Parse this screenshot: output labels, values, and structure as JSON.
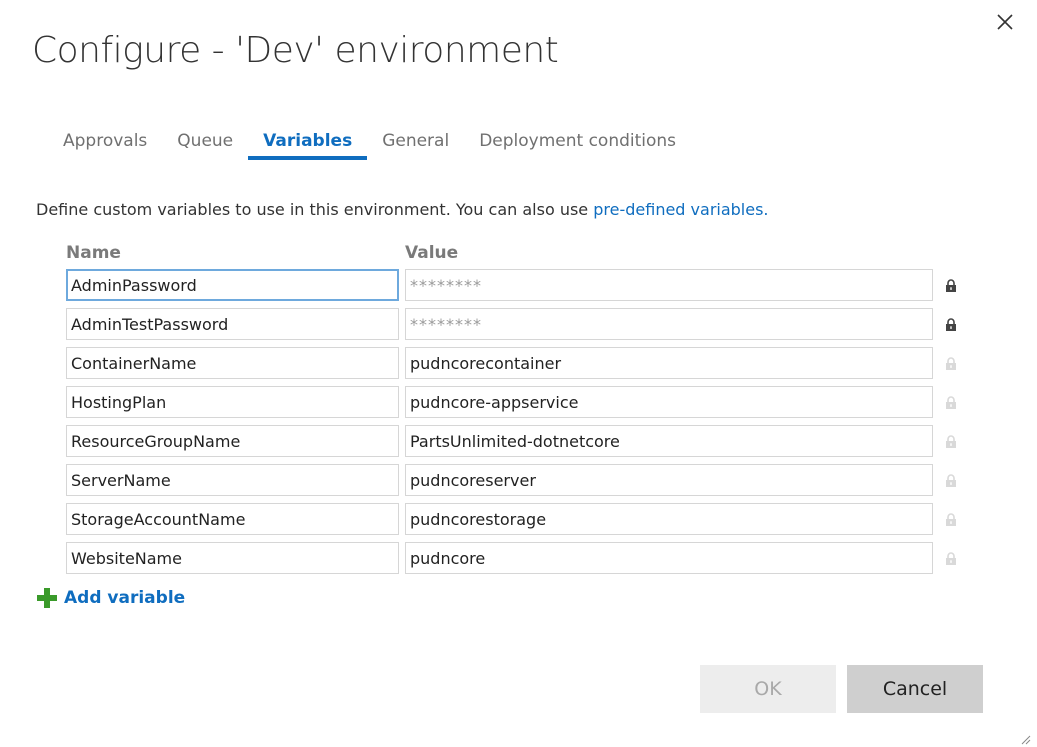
{
  "dialog": {
    "title": "Configure - 'Dev' environment",
    "tabs": [
      {
        "label": "Approvals",
        "active": false
      },
      {
        "label": "Queue",
        "active": false
      },
      {
        "label": "Variables",
        "active": true
      },
      {
        "label": "General",
        "active": false
      },
      {
        "label": "Deployment conditions",
        "active": false
      }
    ],
    "description": "Define custom variables to use in this environment. You can also use",
    "description_link": "pre-defined variables.",
    "columns": {
      "name": "Name",
      "value": "Value"
    },
    "variables": [
      {
        "name": "AdminPassword",
        "value": "********",
        "secret": true
      },
      {
        "name": "AdminTestPassword",
        "value": "********",
        "secret": true
      },
      {
        "name": "ContainerName",
        "value": "pudncorecontainer",
        "secret": false
      },
      {
        "name": "HostingPlan",
        "value": "pudncore-appservice",
        "secret": false
      },
      {
        "name": "ResourceGroupName",
        "value": "PartsUnlimited-dotnetcore",
        "secret": false
      },
      {
        "name": "ServerName",
        "value": "pudncoreserver",
        "secret": false
      },
      {
        "name": "StorageAccountName",
        "value": "pudncorestorage",
        "secret": false
      },
      {
        "name": "WebsiteName",
        "value": "pudncore",
        "secret": false
      }
    ],
    "add_variable_label": "Add variable",
    "ok_label": "OK",
    "cancel_label": "Cancel"
  },
  "icons": {
    "close": "close-icon",
    "lock": "lock-icon",
    "add": "plus-icon",
    "resize": "resize-grip-icon"
  },
  "colors": {
    "accent": "#0f6dbf",
    "add_icon": "#3a9a2a",
    "focus_border": "#6ea9dd"
  }
}
